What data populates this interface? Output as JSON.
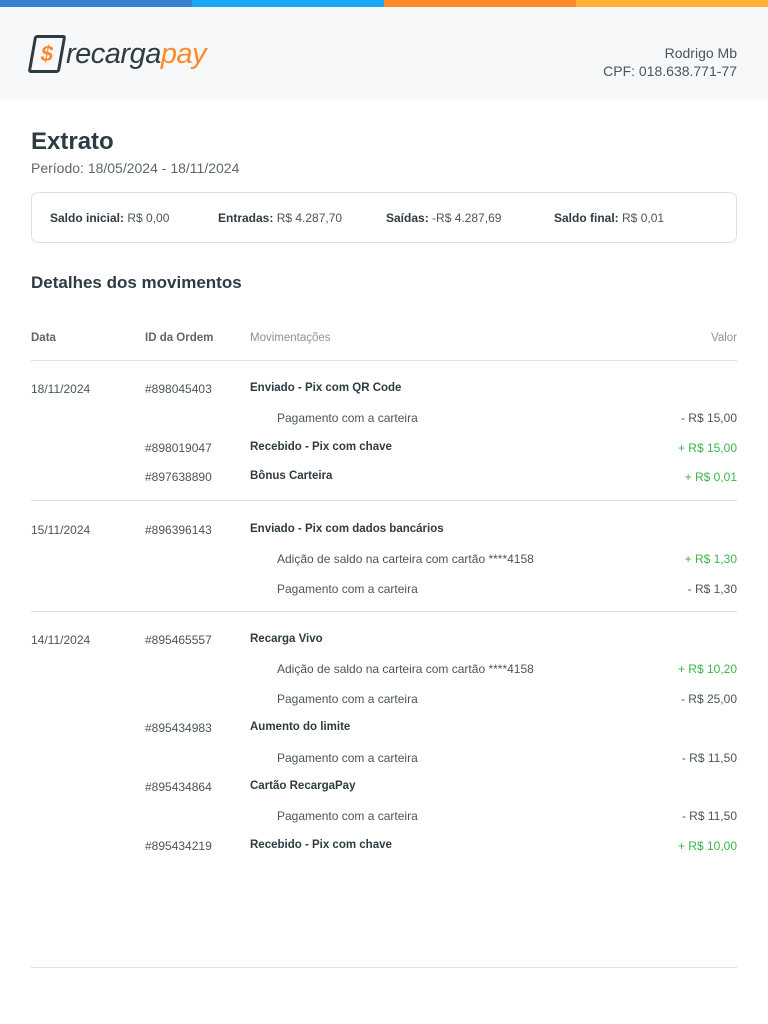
{
  "brand": {
    "name_a": "recarga",
    "name_b": "pay",
    "colors": [
      "#3a80d0",
      "#1aa8f5",
      "#ff8a2b",
      "#ffb133"
    ],
    "green": "#3cb54a"
  },
  "user": {
    "name": "Rodrigo Mb",
    "cpf": "CPF: 018.638.771-77"
  },
  "title": "Extrato",
  "period": "Período: 18/05/2024 - 18/11/2024",
  "summary": [
    {
      "label": "Saldo inicial:",
      "value": "R$ 0,00"
    },
    {
      "label": "Entradas:",
      "value": "R$ 4.287,70"
    },
    {
      "label": "Saídas:",
      "value": "-R$ 4.287,69"
    },
    {
      "label": "Saldo final:",
      "value": "R$ 0,01"
    }
  ],
  "section_title": "Detalhes dos movimentos",
  "columns": {
    "date": "Data",
    "order": "ID da Ordem",
    "movement": "Movimentações",
    "value": "Valor"
  },
  "groups": [
    {
      "date": "18/11/2024",
      "rows": [
        {
          "id": "#898045403",
          "title": "Enviado - Pix com QR Code"
        },
        {
          "sub": "Pagamento com a carteira",
          "value": "- R$ 15,00",
          "pos": false
        },
        {
          "id": "#898019047",
          "title": "Recebido - Pix com chave",
          "value": "+ R$ 15,00",
          "pos": true
        },
        {
          "id": "#897638890",
          "title": "Bônus Carteira",
          "value": "+ R$ 0,01",
          "pos": true
        }
      ]
    },
    {
      "date": "15/11/2024",
      "rows": [
        {
          "id": "#896396143",
          "title": "Enviado - Pix com dados bancários"
        },
        {
          "sub": "Adição de saldo na carteira com cartão ****4158",
          "value": "+ R$ 1,30",
          "pos": true
        },
        {
          "sub": "Pagamento com a carteira",
          "value": "- R$ 1,30",
          "pos": false
        }
      ]
    },
    {
      "date": "14/11/2024",
      "rows": [
        {
          "id": "#895465557",
          "title": "Recarga Vivo"
        },
        {
          "sub": "Adição de saldo na carteira com cartão ****4158",
          "value": "+ R$ 10,20",
          "pos": true
        },
        {
          "sub": "Pagamento com a carteira",
          "value": "- R$ 25,00",
          "pos": false
        },
        {
          "id": "#895434983",
          "title": "Aumento do limite"
        },
        {
          "sub": "Pagamento com a carteira",
          "value": "- R$ 11,50",
          "pos": false
        },
        {
          "id": "#895434864",
          "title": "Cartão RecargaPay"
        },
        {
          "sub": "Pagamento com a carteira",
          "value": "- R$ 11,50",
          "pos": false
        },
        {
          "id": "#895434219",
          "title": "Recebido - Pix com chave",
          "value": "+ R$ 10,00",
          "pos": true
        }
      ]
    }
  ]
}
